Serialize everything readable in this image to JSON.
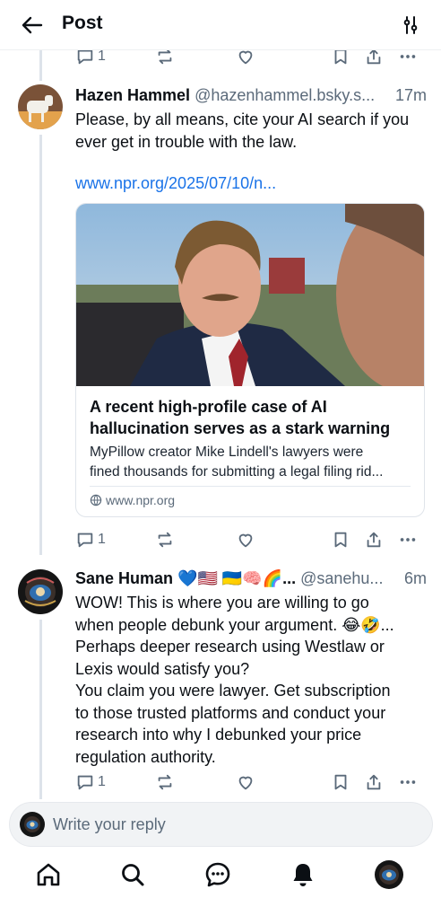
{
  "header": {
    "title": "Post",
    "back_icon": "arrow-left-icon",
    "filter_icon": "sliders-icon"
  },
  "top_actions": {
    "reply_count": "1"
  },
  "post1": {
    "author_name": "Hazen Hammel",
    "handle": "@hazenhammel.bsky.s...",
    "time": "17m",
    "text": "Please, by all means, cite your AI search if you ever get in trouble with the law.",
    "link": "www.npr.org/2025/07/10/n...",
    "card": {
      "title": "A recent high-profile case of AI hallucination serves as a stark warning",
      "desc_line1": "MyPillow creator Mike Lindell's lawyers were",
      "desc_line2": "fined thousands for submitting a legal filing rid...",
      "domain": "www.npr.org"
    },
    "reply_count": "1"
  },
  "post2": {
    "author_name": "Sane Human 💙🇺🇸 🇺🇦🧠🌈...",
    "handle": "@sanehu...",
    "time": "6m",
    "lines": [
      "WOW! This is where you are willing to go",
      "when people debunk your argument. 😂🤣...",
      "Perhaps deeper research using Westlaw or",
      "Lexis would satisfy you?",
      "You claim you were lawyer. Get subscription",
      "to those trusted platforms and conduct your",
      "research into why I debunked your price",
      "regulation authority."
    ],
    "reply_count": "1"
  },
  "reply_box": {
    "placeholder": "Write your reply"
  },
  "tabbar": {
    "items": [
      "home-icon",
      "search-icon",
      "chat-icon",
      "bell-icon",
      "profile-avatar"
    ]
  },
  "colors": {
    "accent": "#1a73e8",
    "muted": "#5b6a7a",
    "text": "#0b0f14"
  }
}
